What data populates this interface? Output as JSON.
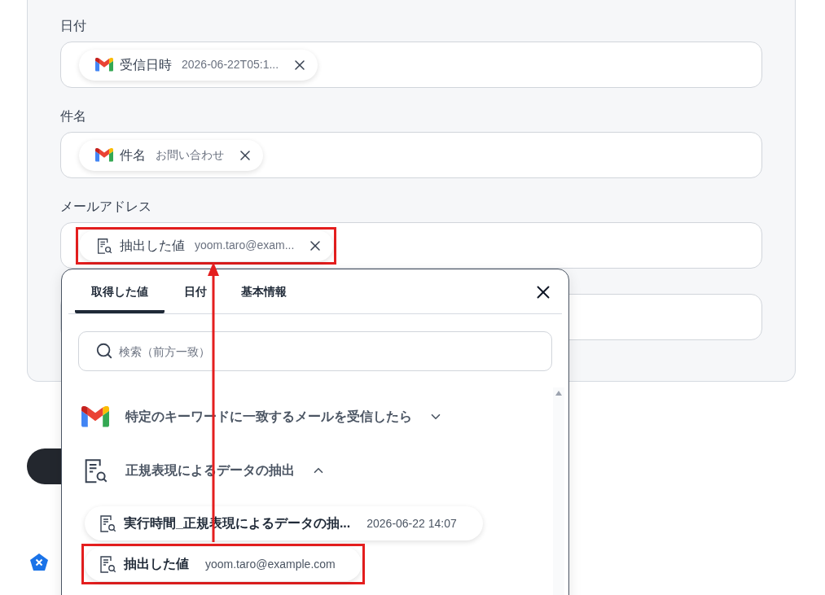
{
  "form": {
    "fields": [
      {
        "kind": "tokens",
        "label": "日付",
        "chips": [
          {
            "kind": "gmail",
            "name": "受信日時",
            "value": "2026-06-22T05:1...",
            "highlighted": false
          }
        ]
      },
      {
        "kind": "tokens",
        "label": "件名",
        "chips": [
          {
            "kind": "gmail",
            "name": "件名",
            "value": "お問い合わせ",
            "highlighted": false
          }
        ]
      },
      {
        "kind": "tokens",
        "label": "メールアドレス",
        "chips": [
          {
            "kind": "extract",
            "name": "抽出した値",
            "value": "yoom.taro@exam...",
            "highlighted": true
          }
        ]
      },
      {
        "kind": "blank"
      }
    ]
  },
  "picker": {
    "tabs": [
      {
        "label": "取得した値",
        "selected": true
      },
      {
        "label": "日付",
        "selected": false
      },
      {
        "label": "基本情報",
        "selected": false
      }
    ],
    "search": {
      "placeholder": "検索（前方一致）"
    },
    "groups": [
      {
        "kind": "gmail",
        "title": "特定のキーワードに一致するメールを受信したら",
        "expanded": false
      },
      {
        "kind": "extract",
        "title": "正規表現によるデータの抽出",
        "expanded": true,
        "children": [
          {
            "name": "実行時間_正規表現によるデータの抽...",
            "value": "2026-06-22 14:07",
            "highlighted": false
          },
          {
            "name": "抽出した値",
            "value": "yoom.taro@example.com",
            "highlighted": true
          }
        ]
      }
    ]
  }
}
